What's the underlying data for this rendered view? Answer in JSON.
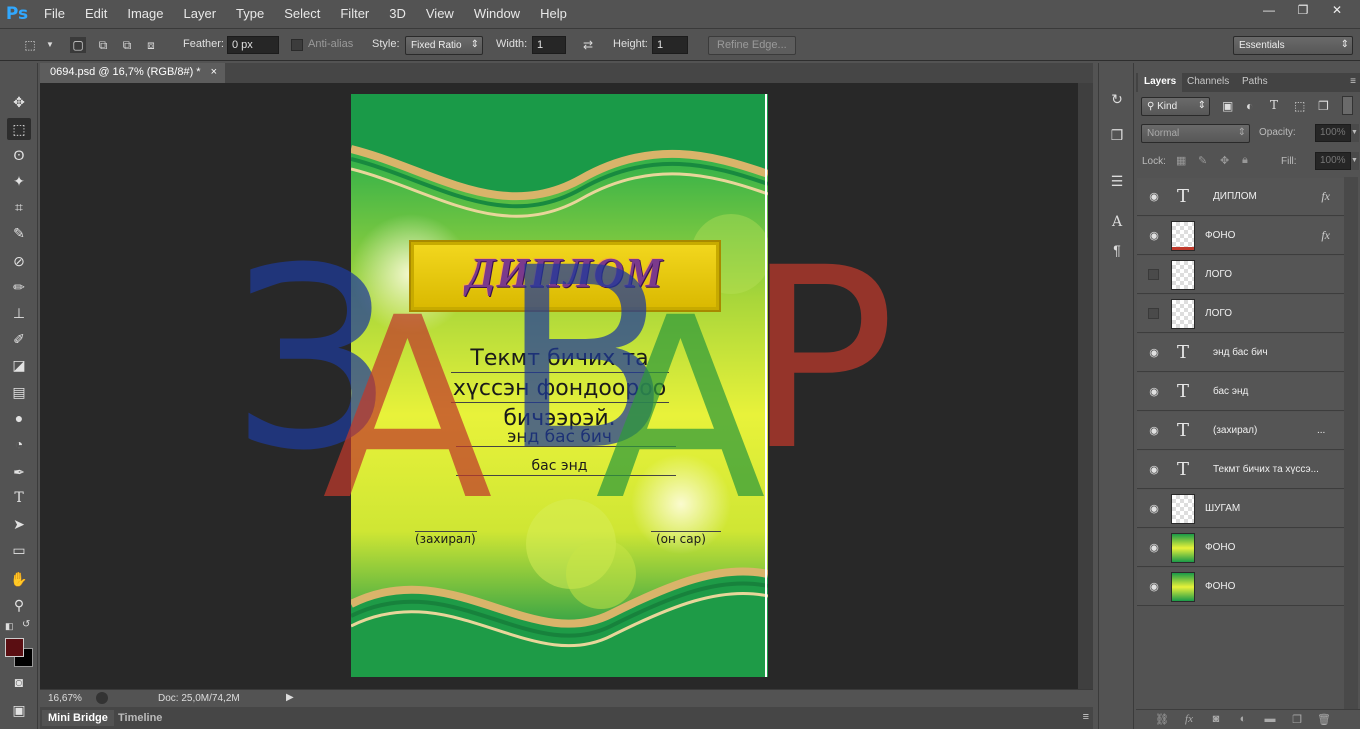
{
  "app": {
    "logo": "Ps"
  },
  "menu": [
    "File",
    "Edit",
    "Image",
    "Layer",
    "Type",
    "Select",
    "Filter",
    "3D",
    "View",
    "Window",
    "Help"
  ],
  "window_controls": {
    "minimize": "—",
    "restore": "❐",
    "close": "✕"
  },
  "options": {
    "feather_label": "Feather:",
    "feather_value": "0 px",
    "antialias_label": "Anti-alias",
    "style_label": "Style:",
    "style_value": "Fixed Ratio",
    "width_label": "Width:",
    "width_value": "1",
    "height_label": "Height:",
    "height_value": "1",
    "refine_edge": "Refine Edge...",
    "workspace": "Essentials"
  },
  "document": {
    "tab_title": "0694.psd @ 16,7% (RGB/8#) *",
    "close": "×",
    "diploma_title": "ДИПЛОМ",
    "body_line1": "Текмт бичих та",
    "body_line2": "хүссэн фондоороо",
    "body_line3": "бичээрэй.",
    "line_a": "энд бас бич",
    "line_b": "бас энд",
    "sign_left": "(захирал)",
    "sign_right": "(он сар)"
  },
  "watermark": {
    "letters": [
      "З",
      "А",
      "В",
      "А",
      "Р"
    ],
    "colors": [
      "#1e3a9a",
      "#c0392b",
      "#1e3a9a",
      "#2e9a3b",
      "#c0392b"
    ]
  },
  "status": {
    "zoom": "16,67%",
    "doc": "Doc: 25,0M/74,2M"
  },
  "bottom_tabs": {
    "mini_bridge": "Mini Bridge",
    "timeline": "Timeline"
  },
  "layers_panel": {
    "tabs": [
      "Layers",
      "Channels",
      "Paths"
    ],
    "kind_filter": "Kind",
    "blend_mode": "Normal",
    "opacity_label": "Opacity:",
    "opacity_value": "100%",
    "lock_label": "Lock:",
    "fill_label": "Fill:",
    "fill_value": "100%",
    "layers": [
      {
        "name": "ДИПЛОМ",
        "type": "text",
        "visible": true,
        "fx": true
      },
      {
        "name": "ФОНО",
        "type": "image",
        "visible": true,
        "fx": true
      },
      {
        "name": "ЛОГО",
        "type": "image",
        "visible": false,
        "fx": false
      },
      {
        "name": "ЛОГО",
        "type": "image",
        "visible": false,
        "fx": false
      },
      {
        "name": "энд бас бич",
        "type": "text",
        "visible": true,
        "fx": false
      },
      {
        "name": "бас энд",
        "type": "text",
        "visible": true,
        "fx": false
      },
      {
        "name": "(захирал)",
        "type": "text",
        "visible": true,
        "fx": false,
        "suffix": "..."
      },
      {
        "name": "Текмт бичих та  хүссэ...",
        "type": "text",
        "visible": true,
        "fx": false
      },
      {
        "name": "ШУГАМ",
        "type": "image",
        "visible": true,
        "fx": false
      },
      {
        "name": "ФОНО",
        "type": "image",
        "visible": true,
        "fx": false
      },
      {
        "name": "ФОНО",
        "type": "image",
        "visible": true,
        "fx": false
      }
    ],
    "fx_label": "fx"
  }
}
